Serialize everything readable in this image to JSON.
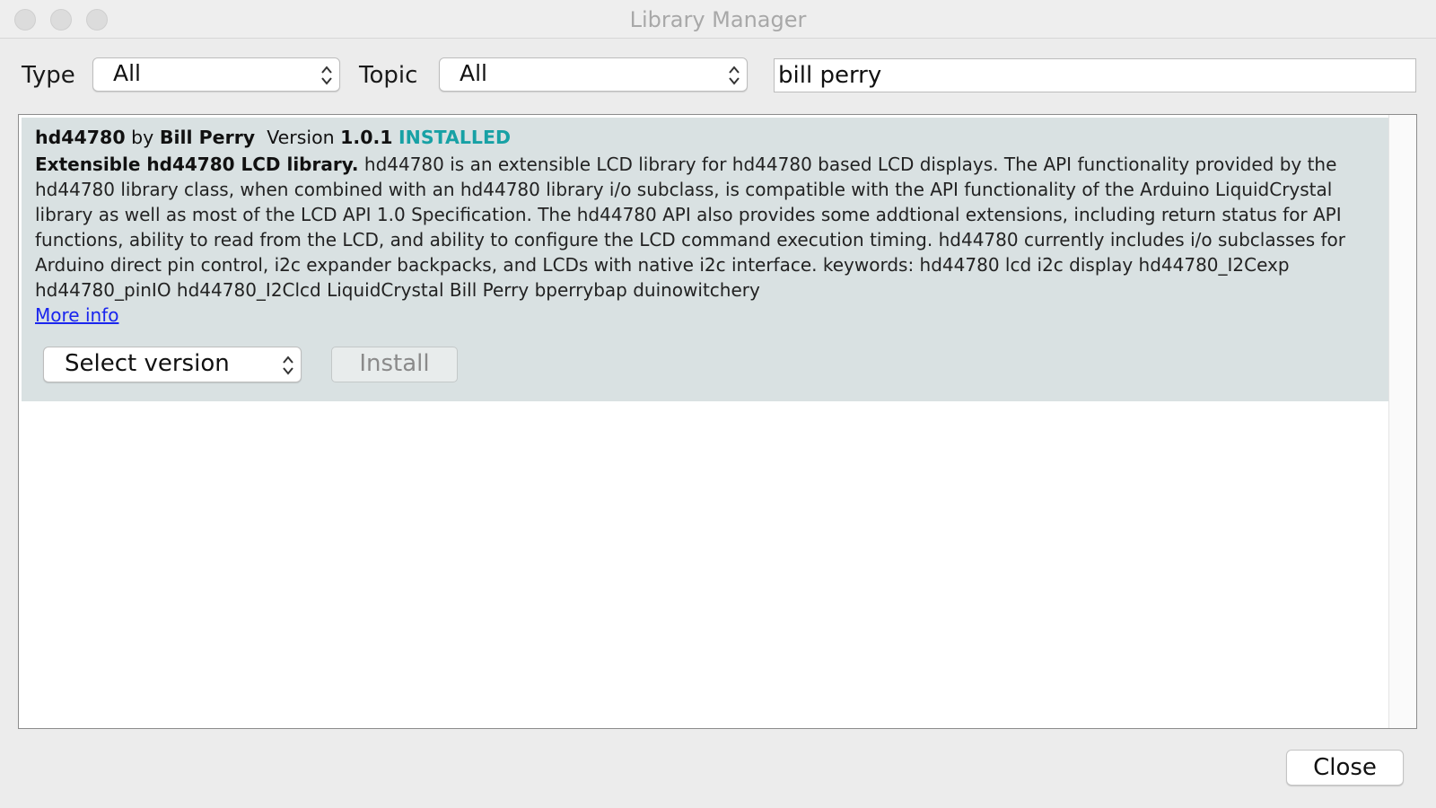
{
  "window": {
    "title": "Library Manager"
  },
  "filters": {
    "type_label": "Type",
    "type_value": "All",
    "topic_label": "Topic",
    "topic_value": "All",
    "search_value": "bill perry"
  },
  "library": {
    "name": "hd44780",
    "by": "by",
    "author": "Bill Perry",
    "version_label": "Version",
    "version": "1.0.1",
    "status": "INSTALLED",
    "summary": "Extensible hd44780 LCD library.",
    "description": "hd44780 is an extensible LCD library for hd44780 based LCD displays. The API functionality provided by the hd44780 library class, when combined with an hd44780 library i/o subclass, is compatible with the API functionality of the Arduino LiquidCrystal library as well as most of the LCD API 1.0 Specification. The hd44780 API also provides some addtional extensions, including return status for API functions, ability to read from the LCD, and ability to configure the LCD command execution timing. hd44780 currently includes i/o subclasses for Arduino direct pin control, i2c expander backpacks, and LCDs with native i2c interface. keywords: hd44780 lcd i2c display hd44780_I2Cexp hd44780_pinIO hd44780_I2Clcd LiquidCrystal Bill Perry bperrybap duinowitchery",
    "more_info": "More info",
    "select_version": "Select version",
    "install": "Install"
  },
  "footer": {
    "close": "Close"
  },
  "colors": {
    "installed": "#17a1a5",
    "item_bg": "#d9e1e2",
    "link": "#1a25ee"
  }
}
